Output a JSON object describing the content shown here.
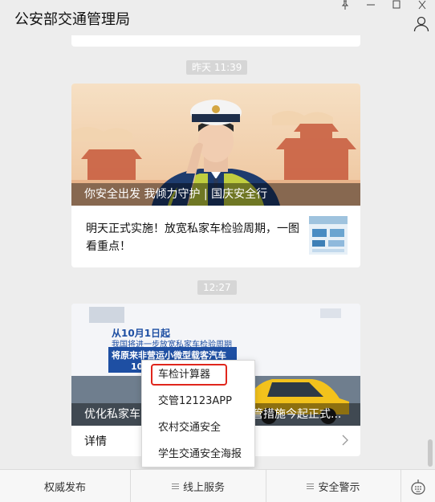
{
  "window": {
    "title": "公安部交通管理局"
  },
  "messages": [
    {
      "timestamp": "昨天  11:39",
      "cover_caption": "你安全出发 我倾力守护 | 国庆安全行",
      "article_title": "明天正式实施！放宽私家车检验周期，一图看重点！"
    },
    {
      "timestamp": "12:27",
      "cover_caption_left": "优化私家车",
      "cover_caption_right": "管措施今起正式...",
      "banner_line1": "从10月1日起",
      "banner_line2": "我国将进一步放宽私家车检验周期",
      "banner_line3": "将原来非营运小微型载客汽车",
      "banner_line4": "10",
      "details_label": "详情"
    }
  ],
  "popup_menu": {
    "items": [
      "车检计算器",
      "交管12123APP",
      "农村交通安全",
      "学生交通安全海报"
    ],
    "highlighted_index": 0,
    "highlight_color": "#e0261c"
  },
  "bottom_menu": {
    "items": [
      "权威发布",
      "线上服务",
      "安全警示"
    ]
  }
}
